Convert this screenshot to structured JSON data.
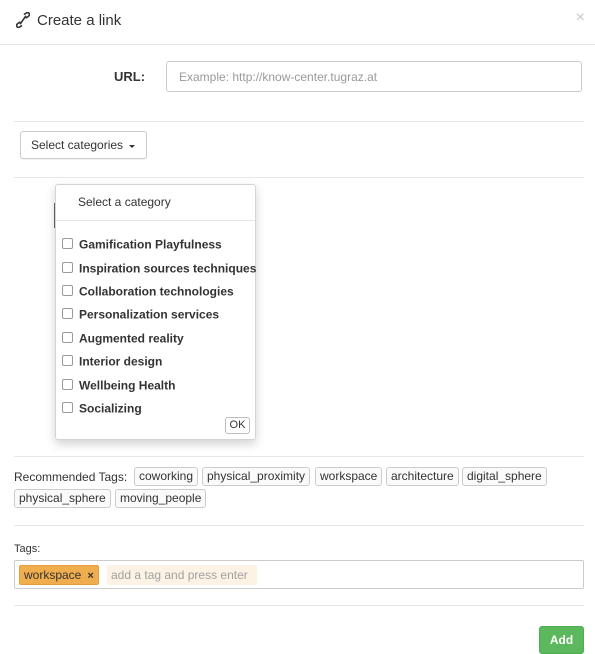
{
  "modal": {
    "title": "Create a link",
    "close_label": "×"
  },
  "url": {
    "label": "URL:",
    "value": "",
    "placeholder": "Example: http://know-center.tugraz.at"
  },
  "categories": {
    "button_label": "Select categories",
    "dropdown_header": "Select a category",
    "items": [
      {
        "label": "Gamification Playfulness",
        "checked": false
      },
      {
        "label": "Inspiration sources techniques",
        "checked": false
      },
      {
        "label": "Collaboration technologies",
        "checked": false
      },
      {
        "label": "Personalization services",
        "checked": false
      },
      {
        "label": "Augmented reality",
        "checked": false
      },
      {
        "label": "Interior design",
        "checked": false
      },
      {
        "label": "Wellbeing Health",
        "checked": false
      },
      {
        "label": "Socializing",
        "checked": false
      }
    ],
    "ok_label": "OK"
  },
  "recommended": {
    "label": "Recommended Tags:",
    "tags": [
      "coworking",
      "physical_proximity",
      "workspace",
      "architecture",
      "digital_sphere",
      "physical_sphere",
      "moving_people"
    ]
  },
  "tags": {
    "label": "Tags:",
    "selected": [
      "workspace"
    ],
    "remove_label": "×",
    "input_placeholder": "add a tag and press enter"
  },
  "add_label": "Add",
  "colors": {
    "add_button": "#5cb85c",
    "selected_tag": "#f0ad4e"
  },
  "icons": {
    "header": "link-icon",
    "close": "close-icon",
    "dropdown": "caret-down-icon",
    "remove_tag": "remove-tag-icon"
  }
}
